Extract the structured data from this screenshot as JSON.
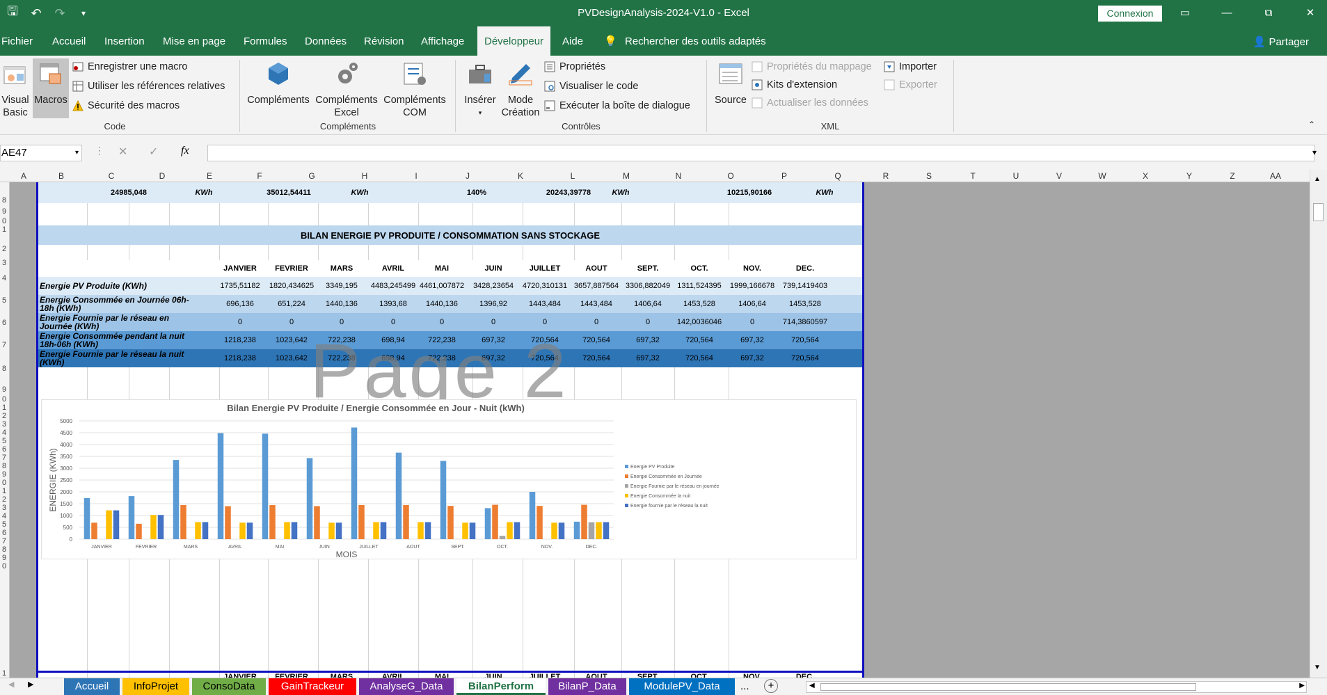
{
  "window": {
    "title": "PVDesignAnalysis-2024-V1.0  -  Excel",
    "connexion": "Connexion",
    "minimize": "—",
    "restore": "⧉",
    "close": "✕",
    "qat_save": "🖫",
    "qat_undo": "↶",
    "qat_redo": "↷",
    "qat_more": "▾"
  },
  "menu": {
    "tabs": [
      "Fichier",
      "Accueil",
      "Insertion",
      "Mise en page",
      "Formules",
      "Données",
      "Révision",
      "Affichage",
      "Développeur",
      "Aide"
    ],
    "search": "Rechercher des outils adaptés",
    "share": "Partager"
  },
  "ribbon": {
    "code": {
      "visual_basic": "Visual Basic",
      "macros": "Macros",
      "record": "Enregistrer une macro",
      "relative": "Utiliser les références relatives",
      "security": "Sécurité des macros",
      "label": "Code"
    },
    "complements": {
      "add": "Compléments",
      "excel": "Compléments Excel",
      "com": "Compléments COM",
      "label": "Compléments"
    },
    "controls": {
      "insert": "Insérer",
      "design": "Mode Création",
      "properties": "Propriétés",
      "view_code": "Visualiser le code",
      "dialog": "Exécuter la boîte de dialogue",
      "label": "Contrôles"
    },
    "xml": {
      "source": "Source",
      "map_props": "Propriétés du mappage",
      "kits": "Kits d'extension",
      "refresh": "Actualiser les données",
      "import": "Importer",
      "export": "Exporter",
      "label": "XML"
    }
  },
  "formula_bar": {
    "name_box": "AE47",
    "fx": "fx"
  },
  "columns": [
    "A",
    "B",
    "C",
    "D",
    "E",
    "F",
    "G",
    "H",
    "I",
    "J",
    "K",
    "L",
    "M",
    "N",
    "O",
    "P",
    "Q",
    "R",
    "S",
    "T",
    "U",
    "V",
    "W",
    "X",
    "Y",
    "Z",
    "AA"
  ],
  "top_row": {
    "v1": "24985,048",
    "u1": "KWh",
    "v2": "35012,54411",
    "u2": "KWh",
    "v3": "140%",
    "v4": "20243,39778",
    "u4": "KWh",
    "v5": "10215,90166",
    "u5": "KWh"
  },
  "section_title": "BILAN ENERGIE PV PRODUITE / CONSOMMATION SANS STOCKAGE",
  "months": [
    "JANVIER",
    "FEVRIER",
    "MARS",
    "AVRIL",
    "MAI",
    "JUIN",
    "JUILLET",
    "AOUT",
    "SEPT.",
    "OCT.",
    "NOV.",
    "DEC."
  ],
  "table_rows": [
    {
      "label": "Energie PV Produite (KWh)",
      "values": [
        "1735,51182",
        "1820,434625",
        "3349,195",
        "4483,245499",
        "4461,007872",
        "3428,23654",
        "4720,310131",
        "3657,887564",
        "3306,882049",
        "1311,524395",
        "1999,166678",
        "739,1419403"
      ]
    },
    {
      "label": "Energie Consommée en Journée 06h-18h (KWh)",
      "values": [
        "696,136",
        "651,224",
        "1440,136",
        "1393,68",
        "1440,136",
        "1396,92",
        "1443,484",
        "1443,484",
        "1406,64",
        "1453,528",
        "1406,64",
        "1453,528"
      ]
    },
    {
      "label": "Energie Fournie par le réseau en Journée (KWh)",
      "values": [
        "0",
        "0",
        "0",
        "0",
        "0",
        "0",
        "0",
        "0",
        "0",
        "142,0036046",
        "0",
        "714,3860597"
      ]
    },
    {
      "label": "Energie Consommée pendant la nuit 18h-06h (KWh)",
      "values": [
        "1218,238",
        "1023,642",
        "722,238",
        "698,94",
        "722,238",
        "697,32",
        "720,564",
        "720,564",
        "697,32",
        "720,564",
        "697,32",
        "720,564"
      ]
    },
    {
      "label": "Energie Fournie par le réseau la nuit (KWh)",
      "values": [
        "1218,238",
        "1023,642",
        "722,238",
        "698,94",
        "722,238",
        "697,32",
        "720,564",
        "720,564",
        "697,32",
        "720,564",
        "697,32",
        "720,564"
      ]
    }
  ],
  "watermark": "Page 2",
  "chart_data": {
    "type": "bar",
    "title": "Bilan Energie PV Produite / Energie Consommée en Jour - Nuit (kWh)",
    "xlabel": "MOIS",
    "ylabel": "ENERGIE (KWh)",
    "ylim": [
      0,
      5000
    ],
    "yticks": [
      "0",
      "500",
      "1000",
      "1500",
      "2000",
      "2500",
      "3000",
      "3500",
      "4000",
      "4500",
      "5000"
    ],
    "categories": [
      "JANVIER",
      "FEVRIER",
      "MARS",
      "AVRIL",
      "MAI",
      "JUIN",
      "JUILLET",
      "AOUT",
      "SEPT.",
      "OCT.",
      "NOV.",
      "DEC."
    ],
    "legend_position": "right",
    "series": [
      {
        "name": "Energie PV Produite",
        "color": "#5b9bd5",
        "values": [
          1735.5,
          1820.4,
          3349.2,
          4483.2,
          4461.0,
          3428.2,
          4720.3,
          3657.9,
          3306.9,
          1311.5,
          1999.2,
          739.1
        ]
      },
      {
        "name": "Energie Consommée en Journée",
        "color": "#ed7d31",
        "values": [
          696.1,
          651.2,
          1440.1,
          1393.7,
          1440.1,
          1396.9,
          1443.5,
          1443.5,
          1406.6,
          1453.5,
          1406.6,
          1453.5
        ]
      },
      {
        "name": "Energie Fournie par le réseau en journée",
        "color": "#a5a5a5",
        "values": [
          0,
          0,
          0,
          0,
          0,
          0,
          0,
          0,
          0,
          142.0,
          0,
          714.4
        ]
      },
      {
        "name": "Energie Consommée la nuit",
        "color": "#ffc000",
        "values": [
          1218.2,
          1023.6,
          722.2,
          698.9,
          722.2,
          697.3,
          720.6,
          720.6,
          697.3,
          720.6,
          697.3,
          720.6
        ]
      },
      {
        "name": "Energie fournie par le réseau la nuit",
        "color": "#4472c4",
        "values": [
          1218.2,
          1023.6,
          722.2,
          698.9,
          722.2,
          697.3,
          720.6,
          720.6,
          697.3,
          720.6,
          697.3,
          720.6
        ]
      }
    ]
  },
  "bottom_peek": [
    "JANVIER",
    "FEVRIER",
    "MARS",
    "AVRIL",
    "MAI",
    "JUIN",
    "JUILLET",
    "AOUT",
    "SEPT.",
    "OCT.",
    "NOV.",
    "DEC."
  ],
  "sheet_tabs": [
    {
      "label": "Accueil",
      "color": "#2e75b6",
      "text": "#ffffff"
    },
    {
      "label": "InfoProjet",
      "color": "#ffc000",
      "text": "#000000"
    },
    {
      "label": "ConsoData",
      "color": "#70ad47",
      "text": "#000000"
    },
    {
      "label": "GainTrackeur",
      "color": "#ff0000",
      "text": "#ffffff"
    },
    {
      "label": "AnalyseG_Data",
      "color": "#7030a0",
      "text": "#ffffff"
    },
    {
      "label": "BilanPerform",
      "color": "#ffffff",
      "text": "#217346"
    },
    {
      "label": "BilanP_Data",
      "color": "#7030a0",
      "text": "#ffffff"
    },
    {
      "label": "ModulePV_Data",
      "color": "#0070c0",
      "text": "#ffffff"
    }
  ],
  "more_sheets": "...",
  "add_sheet": "+"
}
